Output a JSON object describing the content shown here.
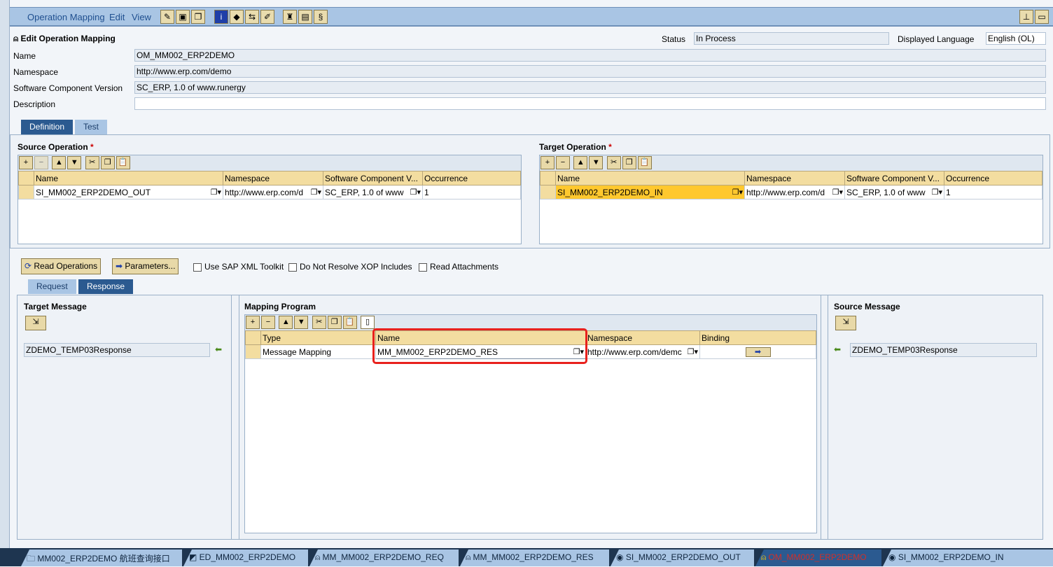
{
  "menu": {
    "items": [
      "Operation Mapping",
      "Edit",
      "View"
    ]
  },
  "header": {
    "title": "Edit Operation Mapping",
    "status_label": "Status",
    "status_value": "In Process",
    "lang_label": "Displayed Language",
    "lang_value": "English (OL)"
  },
  "fields": [
    {
      "label": "Name",
      "value": "OM_MM002_ERP2DEMO"
    },
    {
      "label": "Namespace",
      "value": "http://www.erp.com/demo"
    },
    {
      "label": "Software Component Version",
      "value": "SC_ERP, 1.0 of www.runergy"
    },
    {
      "label": "Description",
      "value": ""
    }
  ],
  "tabs": [
    "Definition",
    "Test"
  ],
  "source_op": {
    "title": "Source Operation",
    "columns": [
      "Name",
      "Namespace",
      "Software Component V...",
      "Occurrence"
    ],
    "row": [
      "SI_MM002_ERP2DEMO_OUT",
      "http://www.erp.com/d",
      "SC_ERP, 1.0 of www",
      "1"
    ]
  },
  "target_op": {
    "title": "Target Operation",
    "columns": [
      "Name",
      "Namespace",
      "Software Component V...",
      "Occurrence"
    ],
    "row": [
      "SI_MM002_ERP2DEMO_IN",
      "http://www.erp.com/d",
      "SC_ERP, 1.0 of www",
      "1"
    ]
  },
  "actions": {
    "read": "Read Operations",
    "params": "Parameters...",
    "opt1": "Use SAP XML Toolkit",
    "opt2": "Do Not Resolve XOP Includes",
    "opt3": "Read Attachments"
  },
  "subtabs": [
    "Request",
    "Response"
  ],
  "target_msg": {
    "title": "Target Message",
    "value": "ZDEMO_TEMP03Response"
  },
  "mapping": {
    "title": "Mapping Program",
    "columns": [
      "Type",
      "Name",
      "Namespace",
      "Binding"
    ],
    "row": [
      "Message Mapping",
      "MM_MM002_ERP2DEMO_RES",
      "http://www.erp.com/demc"
    ]
  },
  "source_msg": {
    "title": "Source Message",
    "value": "ZDEMO_TEMP03Response"
  },
  "bottom_tabs": [
    "MM002_ERP2DEMO 航班查询接口",
    "ED_MM002_ERP2DEMO",
    "MM_MM002_ERP2DEMO_REQ",
    "MM_MM002_ERP2DEMO_RES",
    "SI_MM002_ERP2DEMO_OUT",
    "OM_MM002_ERP2DEMO",
    "SI_MM002_ERP2DEMO_IN"
  ],
  "colors": {
    "accent": "#2b5a90",
    "highlight": "#ffc82e",
    "callout": "#e8211d"
  }
}
